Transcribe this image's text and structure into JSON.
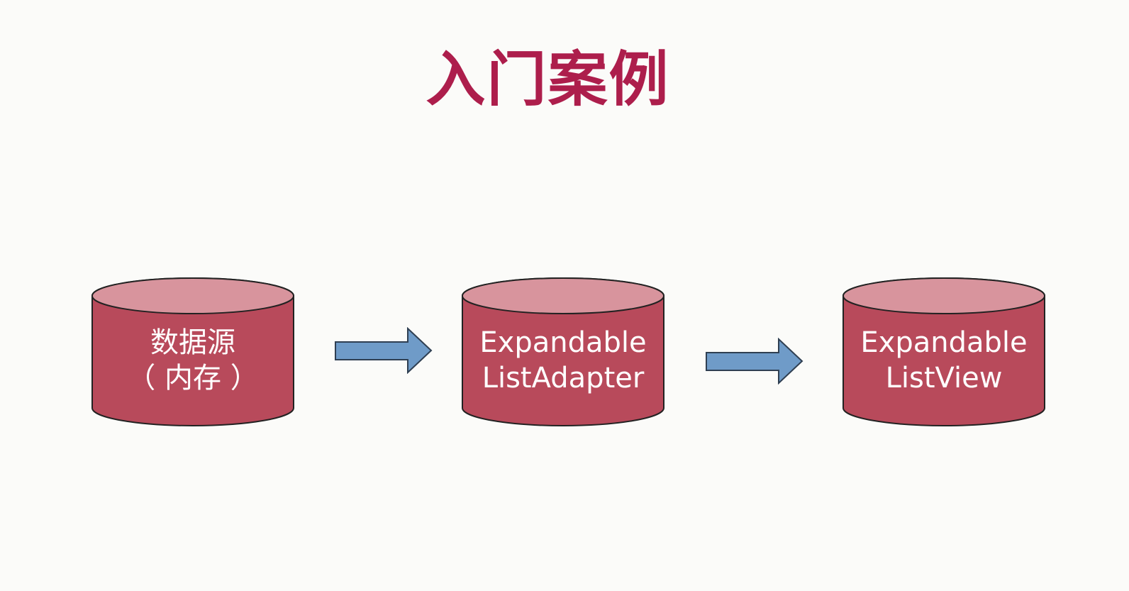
{
  "title": "入门案例",
  "flow": {
    "nodes": [
      {
        "id": "data-source",
        "shape": "cylinder",
        "lines": [
          "数据源",
          "（ 内存 ）"
        ]
      },
      {
        "id": "expandable-list-adapter",
        "shape": "cylinder",
        "lines": [
          "Expandable",
          "ListAdapter"
        ]
      },
      {
        "id": "expandable-list-view",
        "shape": "cylinder",
        "lines": [
          "Expandable",
          "ListView"
        ]
      }
    ],
    "edges": [
      {
        "from": "data-source",
        "to": "expandable-list-adapter",
        "direction": "right"
      },
      {
        "from": "expandable-list-adapter",
        "to": "expandable-list-view",
        "direction": "right"
      }
    ]
  },
  "colors": {
    "title": "#ad1e4c",
    "cylinder_body": "#b84a5b",
    "cylinder_top": "#d8949d",
    "cylinder_outline": "#222222",
    "arrow_fill": "#6f9bc8",
    "arrow_outline": "#2f3f52",
    "background": "#fbfbf9"
  }
}
